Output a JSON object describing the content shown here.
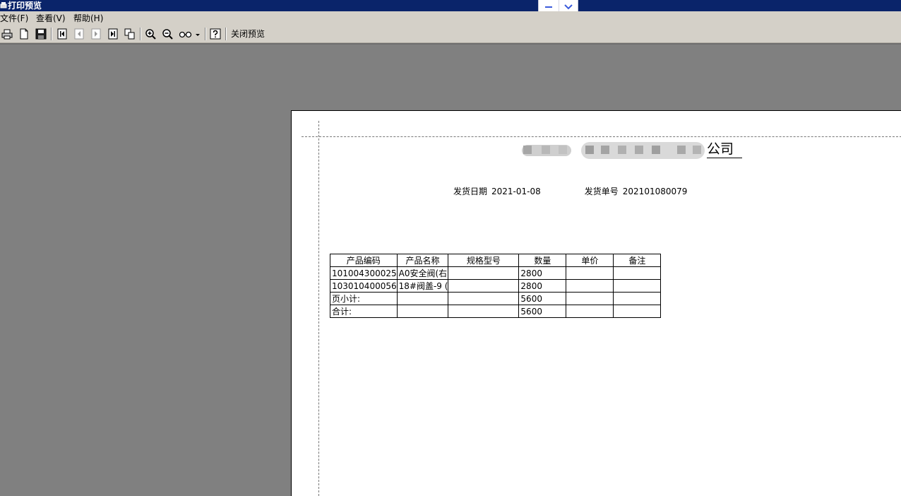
{
  "window": {
    "title": "打印预览"
  },
  "menu": {
    "items": [
      "文件(F)",
      "查看(V)",
      "帮助(H)"
    ]
  },
  "toolbar": {
    "icons": [
      "print-icon",
      "page-setup-icon",
      "save-icon",
      "first-page-icon",
      "prev-page-icon",
      "next-page-icon",
      "last-page-icon",
      "multi-page-icon",
      "zoom-in-icon",
      "zoom-out-icon",
      "glasses-icon",
      "help-icon"
    ],
    "close_label": "关闭预览"
  },
  "report": {
    "company_visible": "公司",
    "date_label": "发货日期",
    "date_value": "2021-01-08",
    "order_label": "发货单号",
    "order_value": "202101080079",
    "columns": [
      "产品编码",
      "产品名称",
      "规格型号",
      "数量",
      "单价",
      "备注"
    ],
    "rows": [
      [
        "101004300025",
        "A0安全阀(右",
        "",
        "2800",
        "",
        ""
      ],
      [
        "103010400056",
        "18#阀盖-9 (",
        "",
        "2800",
        "",
        ""
      ],
      [
        "页小计:",
        "",
        "",
        "5600",
        "",
        ""
      ],
      [
        "合计:",
        "",
        "",
        "5600",
        "",
        ""
      ]
    ]
  },
  "colors": {
    "titlebar": "#0a246a",
    "chrome": "#d4d0c8",
    "workspace": "#808080",
    "floating_accent": "#3b5bdb"
  }
}
